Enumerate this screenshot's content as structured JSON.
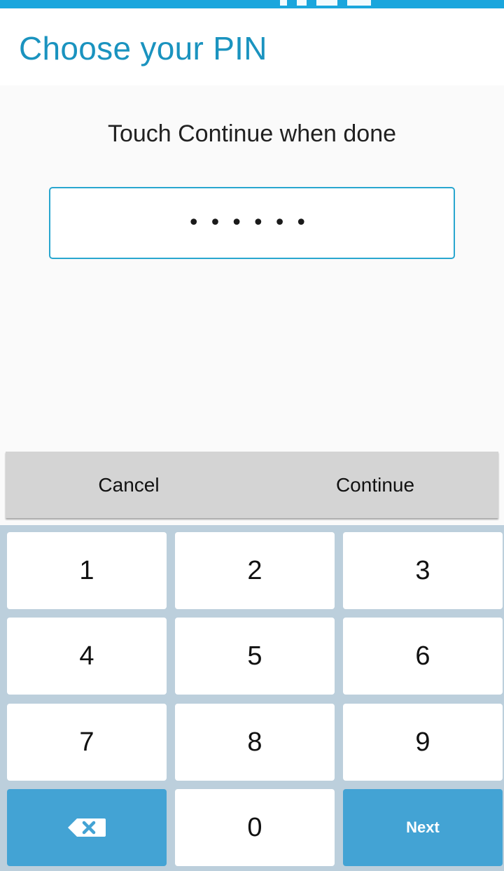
{
  "status_bar": {
    "color": "#1aa6dd"
  },
  "header": {
    "title": "Choose your PIN"
  },
  "content": {
    "instruction": "Touch Continue when done",
    "pin_field": {
      "masked_value": "••••••",
      "length": 6
    }
  },
  "actions": {
    "cancel_label": "Cancel",
    "continue_label": "Continue"
  },
  "keypad": {
    "keys": [
      "1",
      "2",
      "3",
      "4",
      "5",
      "6",
      "7",
      "8",
      "9"
    ],
    "zero": "0",
    "backspace_icon": "backspace-icon",
    "next_label": "Next",
    "accent_color": "#43a3d4"
  }
}
